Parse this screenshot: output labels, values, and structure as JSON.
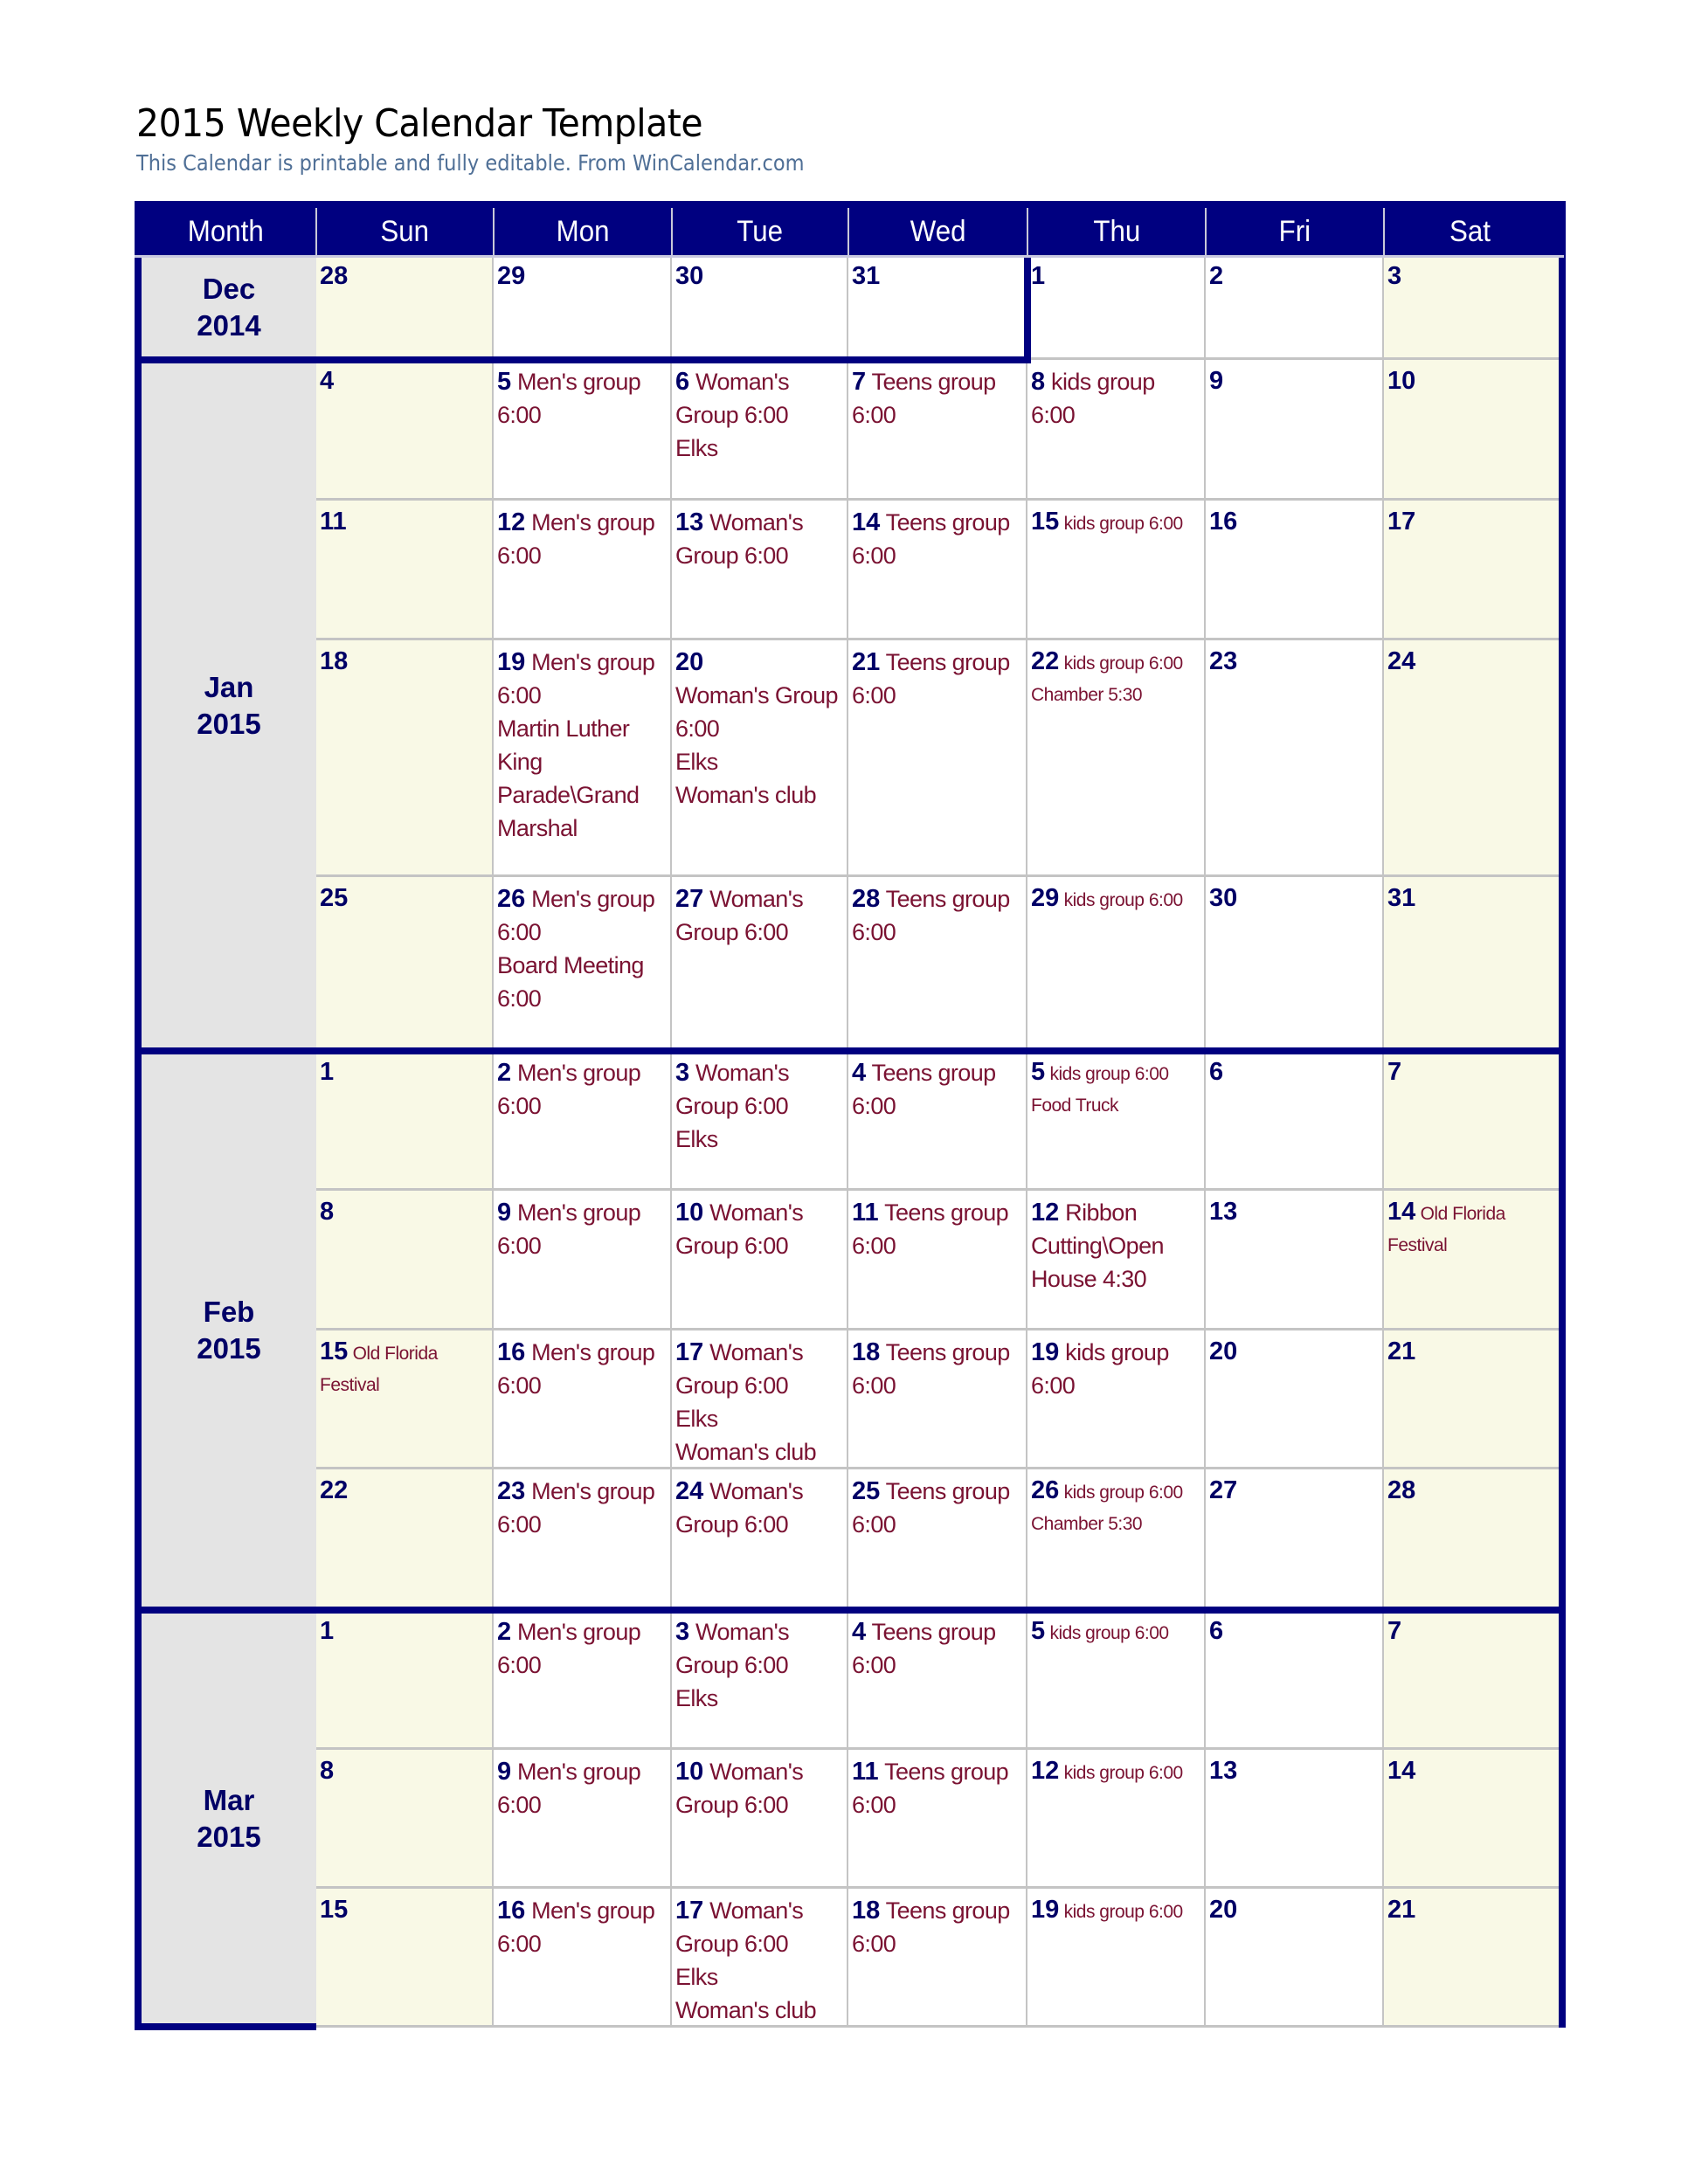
{
  "header": {
    "title": "2015 Weekly Calendar Template",
    "subtitle": "This Calendar is printable and fully editable.  From WinCalendar.com"
  },
  "columns": [
    "Month",
    "Sun",
    "Mon",
    "Tue",
    "Wed",
    "Thu",
    "Fri",
    "Sat"
  ],
  "colors": {
    "header_bg": "#000080",
    "date_text": "#000066",
    "event_text": "#7a1232",
    "weekend_bg": "#f9f9e6",
    "month_bg": "#e4e4e4"
  },
  "months": [
    {
      "label": "Dec",
      "year": "2014",
      "weeks": [
        {
          "days": [
            {
              "date": "28",
              "events": []
            },
            {
              "date": "29",
              "events": []
            },
            {
              "date": "30",
              "events": []
            },
            {
              "date": "31",
              "events": []
            },
            {
              "date": "1",
              "events": []
            },
            {
              "date": "2",
              "events": []
            },
            {
              "date": "3",
              "events": []
            }
          ]
        }
      ]
    },
    {
      "label": "Jan",
      "year": "2015",
      "weeks": [
        {
          "days": [
            {
              "date": "4",
              "events": []
            },
            {
              "date": "5",
              "events": [
                "Men's group",
                "6:00"
              ]
            },
            {
              "date": "6",
              "events": [
                "Woman's",
                "Group 6:00",
                "Elks"
              ]
            },
            {
              "date": "7",
              "events": [
                "Teens group",
                "6:00"
              ]
            },
            {
              "date": "8",
              "events": [
                "kids group",
                "6:00"
              ]
            },
            {
              "date": "9",
              "events": []
            },
            {
              "date": "10",
              "events": []
            }
          ]
        },
        {
          "days": [
            {
              "date": "11",
              "events": []
            },
            {
              "date": "12",
              "events": [
                "Men's group",
                "6:00"
              ]
            },
            {
              "date": "13",
              "events": [
                "Woman's",
                "Group 6:00"
              ]
            },
            {
              "date": "14",
              "events": [
                "Teens group",
                "6:00"
              ]
            },
            {
              "date": "15",
              "events": [
                "kids group 6:00"
              ],
              "small": true
            },
            {
              "date": "16",
              "events": []
            },
            {
              "date": "17",
              "events": []
            }
          ]
        },
        {
          "days": [
            {
              "date": "18",
              "events": []
            },
            {
              "date": "19",
              "events": [
                "Men's group",
                "6:00",
                "Martin Luther",
                "King",
                "Parade\\Grand",
                "Marshal"
              ]
            },
            {
              "date": "20",
              "events": [
                "",
                "Woman's Group",
                "6:00",
                "Elks",
                "Woman's club"
              ]
            },
            {
              "date": "21",
              "events": [
                "Teens group",
                "6:00"
              ]
            },
            {
              "date": "22",
              "events": [
                "kids group 6:00",
                "Chamber 5:30"
              ],
              "small": true
            },
            {
              "date": "23",
              "events": []
            },
            {
              "date": "24",
              "events": []
            }
          ]
        },
        {
          "days": [
            {
              "date": "25",
              "events": []
            },
            {
              "date": "26",
              "events": [
                "Men's group",
                "6:00",
                "Board Meeting",
                "6:00"
              ]
            },
            {
              "date": "27",
              "events": [
                "Woman's",
                "Group 6:00"
              ]
            },
            {
              "date": "28",
              "events": [
                "Teens group",
                "6:00"
              ]
            },
            {
              "date": "29",
              "events": [
                "kids group 6:00"
              ],
              "small": true
            },
            {
              "date": "30",
              "events": []
            },
            {
              "date": "31",
              "events": []
            }
          ]
        }
      ]
    },
    {
      "label": "Feb",
      "year": "2015",
      "weeks": [
        {
          "days": [
            {
              "date": "1",
              "events": []
            },
            {
              "date": "2",
              "events": [
                "Men's group",
                "6:00"
              ]
            },
            {
              "date": "3",
              "events": [
                "Woman's",
                "Group 6:00",
                "Elks"
              ]
            },
            {
              "date": "4",
              "events": [
                "Teens group",
                "6:00"
              ]
            },
            {
              "date": "5",
              "events": [
                "kids group 6:00",
                "Food Truck"
              ],
              "small": true
            },
            {
              "date": "6",
              "events": []
            },
            {
              "date": "7",
              "events": []
            }
          ]
        },
        {
          "days": [
            {
              "date": "8",
              "events": []
            },
            {
              "date": "9",
              "events": [
                "Men's group",
                "6:00"
              ]
            },
            {
              "date": "10",
              "events": [
                "Woman's",
                "Group 6:00"
              ]
            },
            {
              "date": "11",
              "events": [
                "Teens group",
                "6:00"
              ]
            },
            {
              "date": "12",
              "events": [
                "Ribbon",
                "Cutting\\Open",
                "House 4:30"
              ]
            },
            {
              "date": "13",
              "events": []
            },
            {
              "date": "14",
              "events": [
                "Old Florida",
                "Festival"
              ],
              "small": true
            }
          ]
        },
        {
          "days": [
            {
              "date": "15",
              "events": [
                "Old Florida",
                "Festival"
              ],
              "small": true
            },
            {
              "date": "16",
              "events": [
                "Men's group",
                "6:00"
              ]
            },
            {
              "date": "17",
              "events": [
                "Woman's",
                "Group 6:00",
                "Elks",
                "Woman's club"
              ]
            },
            {
              "date": "18",
              "events": [
                "Teens group",
                "6:00"
              ]
            },
            {
              "date": "19",
              "events": [
                "kids group",
                "6:00"
              ]
            },
            {
              "date": "20",
              "events": []
            },
            {
              "date": "21",
              "events": []
            }
          ]
        },
        {
          "days": [
            {
              "date": "22",
              "events": []
            },
            {
              "date": "23",
              "events": [
                "Men's group",
                "6:00"
              ]
            },
            {
              "date": "24",
              "events": [
                "Woman's",
                "Group 6:00"
              ]
            },
            {
              "date": "25",
              "events": [
                "Teens group",
                "6:00"
              ]
            },
            {
              "date": "26",
              "events": [
                "kids group 6:00",
                "Chamber 5:30"
              ],
              "small": true
            },
            {
              "date": "27",
              "events": []
            },
            {
              "date": "28",
              "events": []
            }
          ]
        }
      ]
    },
    {
      "label": "Mar",
      "year": "2015",
      "weeks": [
        {
          "days": [
            {
              "date": "1",
              "events": []
            },
            {
              "date": "2",
              "events": [
                "Men's group",
                "6:00"
              ]
            },
            {
              "date": "3",
              "events": [
                "Woman's",
                "Group 6:00",
                "Elks"
              ]
            },
            {
              "date": "4",
              "events": [
                "Teens group",
                "6:00"
              ]
            },
            {
              "date": "5",
              "events": [
                "kids group 6:00"
              ],
              "small": true
            },
            {
              "date": "6",
              "events": []
            },
            {
              "date": "7",
              "events": []
            }
          ]
        },
        {
          "days": [
            {
              "date": "8",
              "events": []
            },
            {
              "date": "9",
              "events": [
                "Men's group",
                "6:00"
              ]
            },
            {
              "date": "10",
              "events": [
                "Woman's",
                "Group 6:00"
              ]
            },
            {
              "date": "11",
              "events": [
                "Teens group",
                "6:00"
              ]
            },
            {
              "date": "12",
              "events": [
                "kids group 6:00"
              ],
              "small": true
            },
            {
              "date": "13",
              "events": []
            },
            {
              "date": "14",
              "events": []
            }
          ]
        },
        {
          "days": [
            {
              "date": "15",
              "events": []
            },
            {
              "date": "16",
              "events": [
                "Men's group",
                "6:00"
              ]
            },
            {
              "date": "17",
              "events": [
                "Woman's",
                "Group 6:00",
                "Elks",
                "Woman's club"
              ]
            },
            {
              "date": "18",
              "events": [
                "Teens group",
                "6:00"
              ]
            },
            {
              "date": "19",
              "events": [
                "kids group 6:00"
              ],
              "small": true
            },
            {
              "date": "20",
              "events": []
            },
            {
              "date": "21",
              "events": []
            }
          ]
        }
      ]
    }
  ]
}
